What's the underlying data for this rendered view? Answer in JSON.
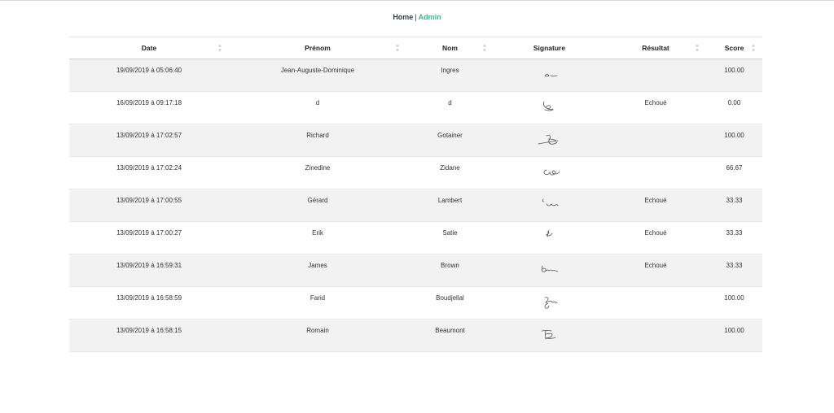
{
  "nav": {
    "home": "Home",
    "separator": "|",
    "admin": "Admin"
  },
  "table": {
    "headers": {
      "date": "Date",
      "prenom": "Prénom",
      "nom": "Nom",
      "signature": "Signature",
      "resultat": "Résultat",
      "score": "Score"
    },
    "rows": [
      {
        "date": "19/09/2019 à 05:06:40",
        "prenom": "Jean-Auguste-Dominique",
        "nom": "Ingres",
        "resultat": "",
        "score": "100.00"
      },
      {
        "date": "16/09/2019 à 09:17:18",
        "prenom": "d",
        "nom": "d",
        "resultat": "Echoué",
        "score": "0.00"
      },
      {
        "date": "13/09/2019 à 17:02:57",
        "prenom": "Richard",
        "nom": "Gotainer",
        "resultat": "",
        "score": "100.00"
      },
      {
        "date": "13/09/2019 à 17:02:24",
        "prenom": "Zinedine",
        "nom": "Zidane",
        "resultat": "",
        "score": "66.67"
      },
      {
        "date": "13/09/2019 à 17:00:55",
        "prenom": "Gérard",
        "nom": "Lambert",
        "resultat": "Echoué",
        "score": "33.33"
      },
      {
        "date": "13/09/2019 à 17:00:27",
        "prenom": "Erik",
        "nom": "Satie",
        "resultat": "Echoué",
        "score": "33.33"
      },
      {
        "date": "13/09/2019 à 16:59:31",
        "prenom": "James",
        "nom": "Brown",
        "resultat": "Echoué",
        "score": "33.33"
      },
      {
        "date": "13/09/2019 à 16:58:59",
        "prenom": "Farid",
        "nom": "Boudjellal",
        "resultat": "",
        "score": "100.00"
      },
      {
        "date": "13/09/2019 à 16:58:15",
        "prenom": "Romain",
        "nom": "Beaumont",
        "resultat": "",
        "score": "100.00"
      }
    ]
  },
  "colors": {
    "nav_home": "#2c3e50",
    "nav_admin": "#42b983",
    "row_stripe": "#f2f2f2"
  },
  "icons": {
    "sort": "sort-arrows-icon",
    "signature": "signature-image"
  }
}
